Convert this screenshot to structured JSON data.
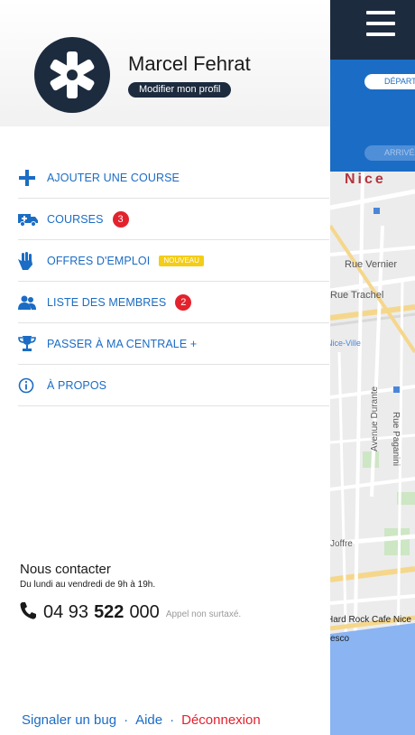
{
  "profile": {
    "name": "Marcel Fehrat",
    "edit_label": "Modifier mon profil"
  },
  "menu": [
    {
      "label": "AJOUTER UNE COURSE",
      "icon": "plus-icon"
    },
    {
      "label": "COURSES",
      "icon": "ambulance-icon",
      "badge": "3"
    },
    {
      "label": "OFFRES D'EMPLOI",
      "icon": "hand-icon",
      "tag": "NOUVEAU"
    },
    {
      "label": "LISTE DES MEMBRES",
      "icon": "members-icon",
      "badge": "2"
    },
    {
      "label": "PASSER À MA CENTRALE +",
      "icon": "trophy-icon"
    },
    {
      "label": "À PROPOS",
      "icon": "info-icon"
    }
  ],
  "contact": {
    "title": "Nous contacter",
    "hours": "Du lundi au vendredi de 9h à 19h.",
    "phone_prefix": "04 93",
    "phone_main": "522",
    "phone_suffix": "000",
    "phone_note": "Appel non surtaxé."
  },
  "footer": {
    "bug": "Signaler un bug",
    "help": "Aide",
    "logout": "Déconnexion",
    "separator": "·"
  },
  "map": {
    "depart": "DÉPART",
    "arrive": "ARRIVÉE",
    "city": "Nice",
    "labels": {
      "vernier": "Rue Vernier",
      "trachel": "Rue Trachel",
      "ville": "Nice-Ville",
      "durante": "Avenue Durante",
      "paganini": "Rue Paganini",
      "joffre": "Joffre",
      "hardrock": "Hard Rock Cafe Nice",
      "fresco": "esco"
    }
  },
  "colors": {
    "accent": "#1b6cc4",
    "navy": "#1d2b3f",
    "alert": "#e3222d",
    "new_tag": "#f3cd16"
  }
}
